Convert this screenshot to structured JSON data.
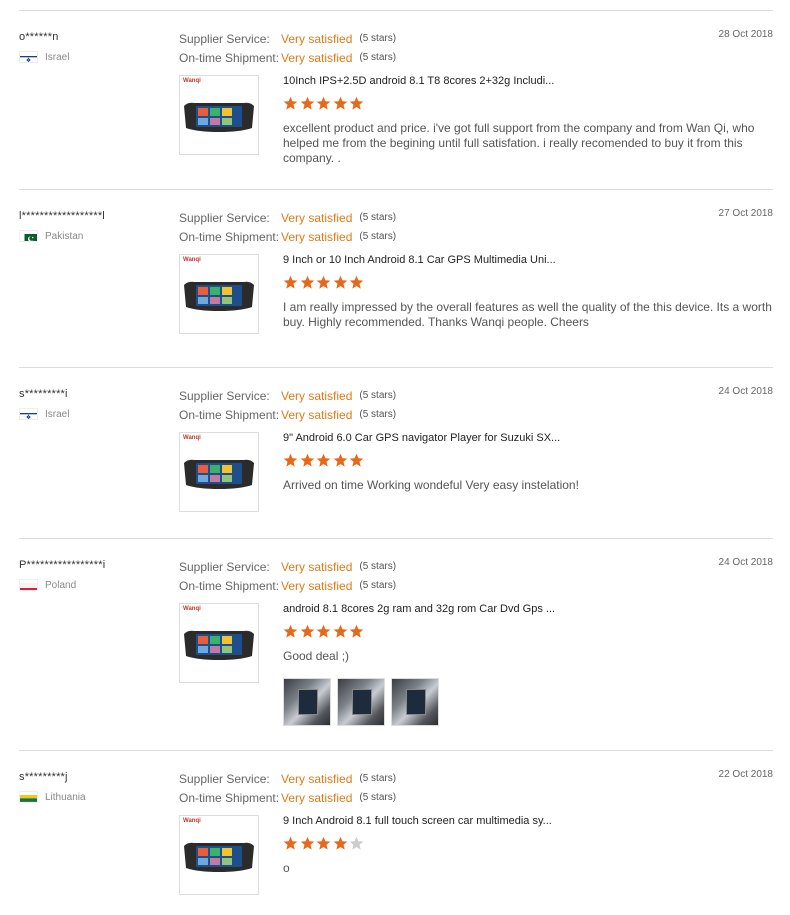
{
  "labels": {
    "supplier_service": "Supplier Service:",
    "on_time_shipment": "On-time Shipment:",
    "stars_suffix": "(5 stars)"
  },
  "colors": {
    "accent": "#e07a16",
    "star_filled": "#e8681a",
    "star_empty": "#cccccc"
  },
  "reviews": [
    {
      "buyer": "o******n",
      "country": "Israel",
      "flag": "israel-flag",
      "supplier_service": "Very satisfied",
      "supplier_stars": "(5 stars)",
      "on_time_shipment": "Very satisfied",
      "shipment_stars": "(5 stars)",
      "date": "28 Oct 2018",
      "thumb_brand": "Wanqi",
      "product_title": "10Inch IPS+2.5D android 8.1 T8 8cores 2+32g Includi...",
      "rating": 5,
      "text": "excellent product and price. i've got full support from the company and from Wan Qi, who helped me from the begining until full satisfation. i really recomended to buy it from this company. .",
      "photos": []
    },
    {
      "buyer": "l******************l",
      "country": "Pakistan",
      "flag": "pakistan-flag",
      "supplier_service": "Very satisfied",
      "supplier_stars": "(5 stars)",
      "on_time_shipment": "Very satisfied",
      "shipment_stars": "(5 stars)",
      "date": "27 Oct 2018",
      "thumb_brand": "Wanqi",
      "product_title": "9 Inch or 10 Inch Android 8.1 Car GPS Multimedia Uni...",
      "rating": 5,
      "text": "I am really impressed by the overall features as well the quality of the this device. Its a worth buy. Highly recommended. Thanks Wanqi people. Cheers",
      "photos": []
    },
    {
      "buyer": "s*********i",
      "country": "Israel",
      "flag": "israel-flag",
      "supplier_service": "Very satisfied",
      "supplier_stars": "(5 stars)",
      "on_time_shipment": "Very satisfied",
      "shipment_stars": "(5 stars)",
      "date": "24 Oct 2018",
      "thumb_brand": "Wanqi",
      "product_title": "9\" Android 6.0 Car GPS navigator Player for Suzuki SX...",
      "rating": 5,
      "text": "Arrived on time Working wondeful Very easy instelation!",
      "photos": []
    },
    {
      "buyer": "P*****************i",
      "country": "Poland",
      "flag": "poland-flag",
      "supplier_service": "Very satisfied",
      "supplier_stars": "(5 stars)",
      "on_time_shipment": "Very satisfied",
      "shipment_stars": "(5 stars)",
      "date": "24 Oct 2018",
      "thumb_brand": "Wanqi",
      "product_title": "android 8.1 8cores 2g ram and 32g rom Car Dvd Gps ...",
      "rating": 5,
      "text": "Good deal ;)",
      "photos": [
        "photo-1",
        "photo-2",
        "photo-3"
      ]
    },
    {
      "buyer": "s*********j",
      "country": "Lithuania",
      "flag": "lithuania-flag",
      "supplier_service": "Very satisfied",
      "supplier_stars": "(5 stars)",
      "on_time_shipment": "Very satisfied",
      "shipment_stars": "(5 stars)",
      "date": "22 Oct 2018",
      "thumb_brand": "Wanqi",
      "product_title": "9 Inch Android 8.1 full touch screen car multimedia sy...",
      "rating": 4,
      "text": "o",
      "photos": []
    }
  ]
}
